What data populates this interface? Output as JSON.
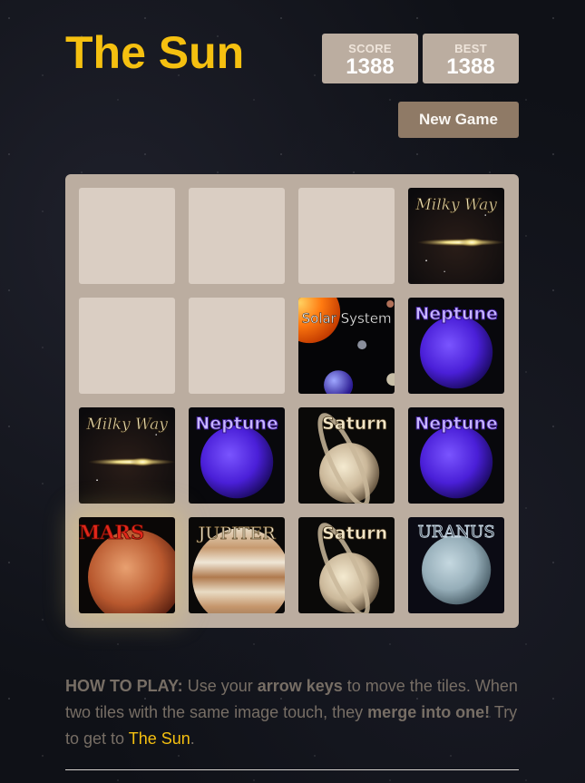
{
  "header": {
    "title": "The Sun"
  },
  "scores": {
    "score_label": "SCORE",
    "score_value": "1388",
    "best_label": "BEST",
    "best_value": "1388"
  },
  "controls": {
    "new_game_label": "New Game"
  },
  "board": {
    "size": 4,
    "rows": [
      [
        "",
        "",
        "",
        "Milky Way"
      ],
      [
        "",
        "",
        "Solar System",
        "Neptune"
      ],
      [
        "Milky Way",
        "Neptune",
        "Saturn",
        "Neptune"
      ],
      [
        "Mars",
        "Jupiter",
        "Saturn",
        "Uranus"
      ]
    ]
  },
  "tiles": {
    "milky_way": {
      "label": "Milky Way",
      "icon": "milky-way-icon"
    },
    "solar_system": {
      "label": "Solar System",
      "icon": "solar-system-icon"
    },
    "neptune": {
      "label": "Neptune",
      "icon": "neptune-icon"
    },
    "saturn": {
      "label": "Saturn",
      "icon": "saturn-icon"
    },
    "mars": {
      "label": "MARS",
      "icon": "mars-icon"
    },
    "jupiter": {
      "label": "JUPITER",
      "icon": "jupiter-icon"
    },
    "uranus": {
      "label": "URANUS",
      "icon": "uranus-icon"
    }
  },
  "instructions": {
    "how_to": "HOW TO PLAY:",
    "text1": " Use your ",
    "arrow_keys": "arrow keys",
    "text2": " to move the tiles. When two tiles with the same image touch, they ",
    "merge": "merge into one!",
    "text3": " Try to get to ",
    "goal": "The Sun",
    "text4": "."
  },
  "colors": {
    "title": "#f5c010",
    "board": "#bbada0",
    "empty_cell": "#d3c6b8",
    "button": "#8f7a66",
    "text": "#776e65",
    "background": "#0f1117"
  }
}
